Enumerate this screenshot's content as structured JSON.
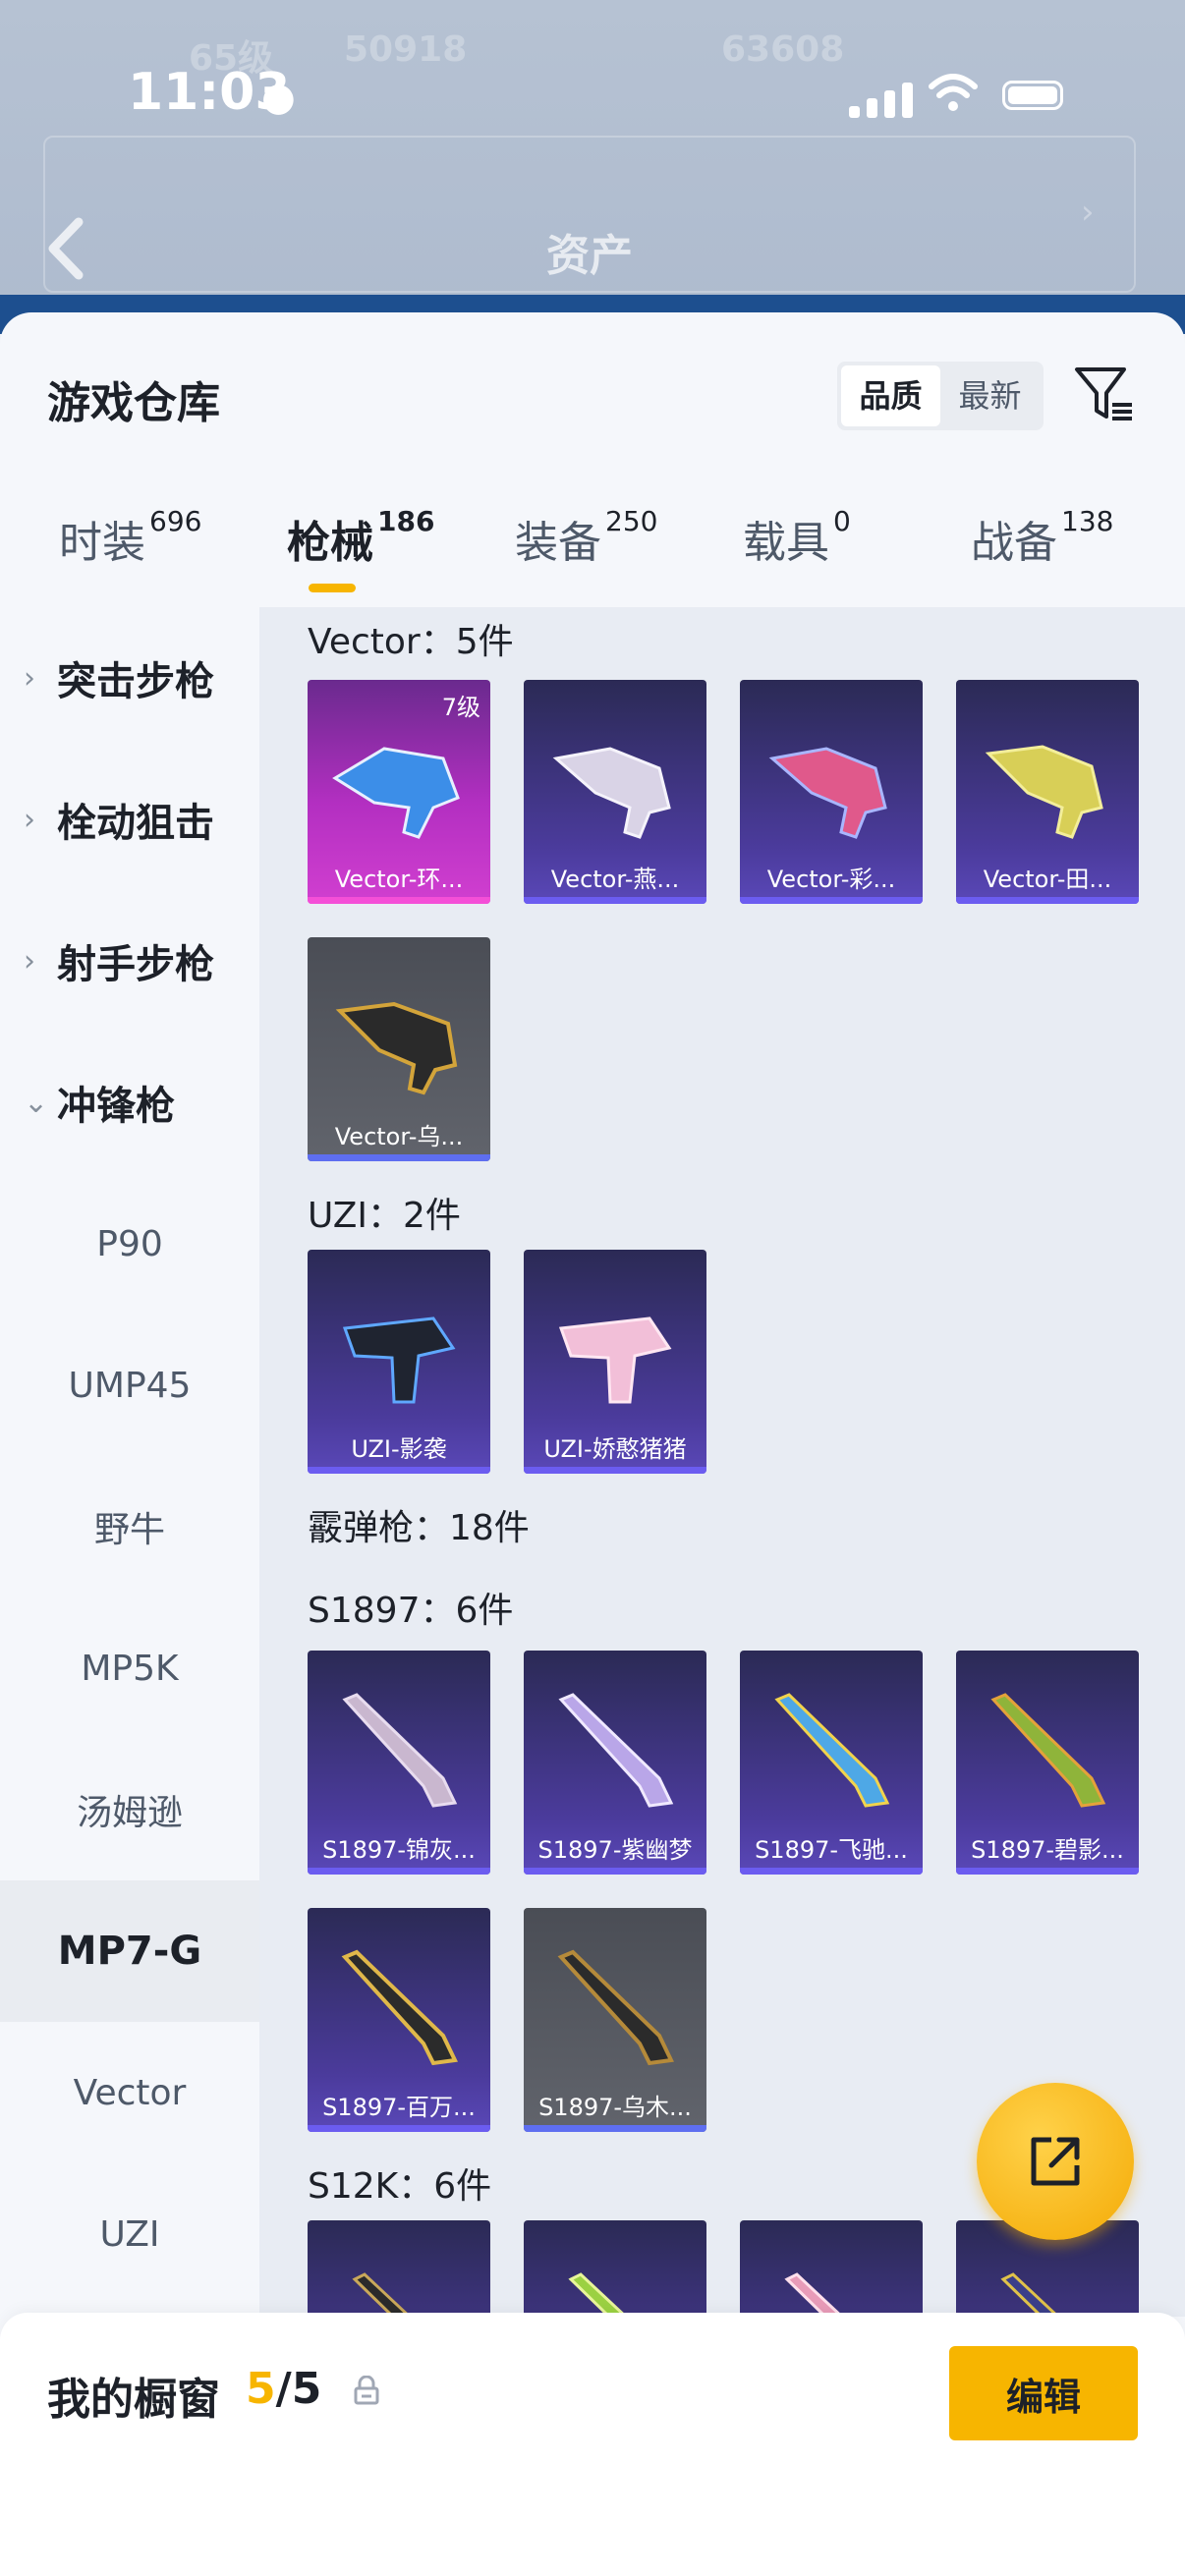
{
  "status_bar": {
    "time": "11:03"
  },
  "background": {
    "ghost_left": "65级",
    "ghost_left2": "50918",
    "ghost_right": "63608",
    "nav_title": "资产"
  },
  "sheet": {
    "title": "游戏仓库",
    "sort_options": [
      "品质",
      "最新"
    ],
    "sort_selected": "品质"
  },
  "tabs": [
    {
      "label": "时装",
      "count": "696",
      "active": false
    },
    {
      "label": "枪械",
      "count": "186",
      "active": true
    },
    {
      "label": "装备",
      "count": "250",
      "active": false
    },
    {
      "label": "载具",
      "count": "0",
      "active": false
    },
    {
      "label": "战备",
      "count": "138",
      "active": false
    }
  ],
  "sidebar": {
    "groups": [
      {
        "label": "突击步枪",
        "expanded": false
      },
      {
        "label": "栓动狙击",
        "expanded": false
      },
      {
        "label": "射手步枪",
        "expanded": false
      },
      {
        "label": "冲锋枪",
        "expanded": true
      }
    ],
    "subitems": [
      {
        "label": "P90"
      },
      {
        "label": "UMP45"
      },
      {
        "label": "野牛"
      },
      {
        "label": "MP5K"
      },
      {
        "label": "汤姆逊"
      },
      {
        "label": "MP7-G",
        "selected": true
      },
      {
        "label": "Vector"
      },
      {
        "label": "UZI"
      }
    ]
  },
  "sections": [
    {
      "title": "Vector：5件",
      "items": [
        {
          "label": "Vector-环...",
          "level": "7级",
          "rarity": "pink"
        },
        {
          "label": "Vector-燕...",
          "rarity": "purple"
        },
        {
          "label": "Vector-彩...",
          "rarity": "purple"
        },
        {
          "label": "Vector-田...",
          "rarity": "purple"
        },
        {
          "label": "Vector-乌...",
          "rarity": "grey"
        }
      ]
    },
    {
      "title": "UZI：2件",
      "items": [
        {
          "label": "UZI-影袭",
          "rarity": "purple"
        },
        {
          "label": "UZI-娇憨猪猪",
          "rarity": "purple"
        }
      ]
    },
    {
      "title": "霰弹枪：18件",
      "items": []
    },
    {
      "title": "S1897：6件",
      "items": [
        {
          "label": "S1897-锦灰...",
          "rarity": "purple"
        },
        {
          "label": "S1897-紫幽梦",
          "rarity": "purple"
        },
        {
          "label": "S1897-飞驰...",
          "rarity": "purple"
        },
        {
          "label": "S1897-碧影...",
          "rarity": "purple"
        },
        {
          "label": "S1897-百万...",
          "rarity": "purple"
        },
        {
          "label": "S1897-乌木...",
          "rarity": "grey"
        }
      ]
    },
    {
      "title": "S12K：6件",
      "items": []
    }
  ],
  "showcase": {
    "label": "我的橱窗",
    "current": "5",
    "total": "/5",
    "edit_label": "编辑"
  },
  "colors": {
    "accent": "#f7b500",
    "purple_bar": "#6b5cf0",
    "pink": "#d13fd0"
  }
}
